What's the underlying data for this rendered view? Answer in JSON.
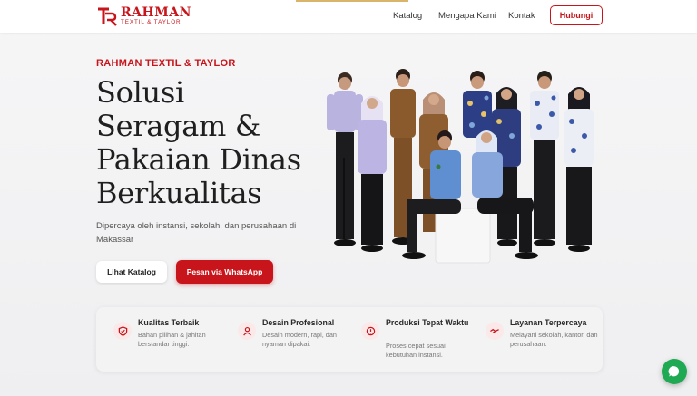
{
  "brand": {
    "name": "RAHMAN",
    "tagline": "TEXTIL & TAYLOR",
    "color": "#c8151b"
  },
  "nav": {
    "links": [
      "Katalog",
      "Mengapa Kami",
      "Kontak"
    ],
    "cta": "Hubungi"
  },
  "hero": {
    "eyebrow": "RAHMAN TEXTIL & TAYLOR",
    "headline_lines": [
      "Solusi",
      "Seragam &",
      "Pakaian Dinas",
      "Berkualitas"
    ],
    "lead": "Dipercaya oleh instansi, sekolah, dan perusahaan di Makassar",
    "btn_catalog": "Lihat Katalog",
    "btn_whatsapp": "Pesan via WhatsApp"
  },
  "features": [
    {
      "icon": "shield-icon",
      "title": "Kualitas Terbaik",
      "desc": "Bahan pilihan & jahitan berstandar tinggi."
    },
    {
      "icon": "user-icon",
      "title": "Desain Profesional",
      "desc": "Desain modern, rapi, dan nyaman dipakai."
    },
    {
      "icon": "factory-icon",
      "title": "Produksi Tepat Waktu",
      "desc": "Proses cepat sesuai kebutuhan instansi."
    },
    {
      "icon": "handshake-icon",
      "title": "Layanan Terpercaya",
      "desc": "Melayani sekolah, kantor, dan perusahaan."
    }
  ],
  "colors": {
    "accent": "#c8151b",
    "whatsapp": "#1ea952"
  }
}
